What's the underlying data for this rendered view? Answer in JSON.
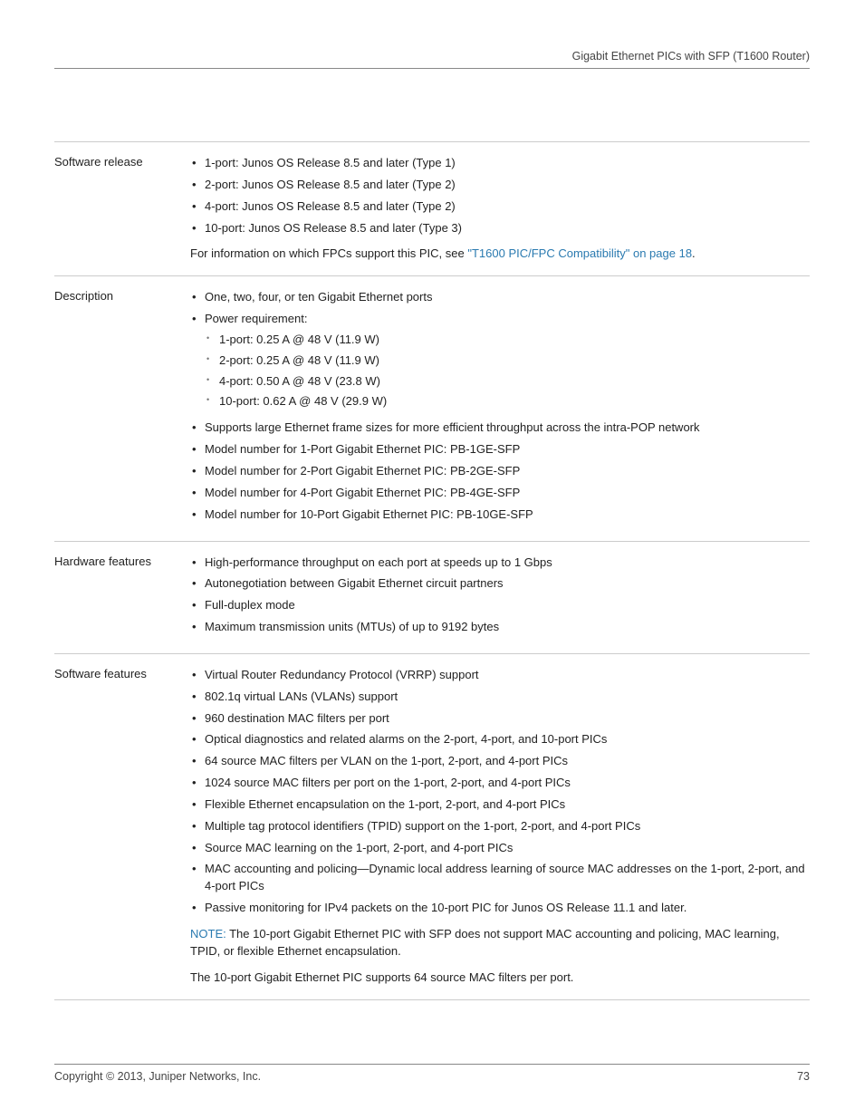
{
  "header": {
    "title": "Gigabit Ethernet PICs with SFP (T1600 Router)"
  },
  "rows": {
    "software_release": {
      "label": "Software release",
      "items": [
        "1-port: Junos OS Release 8.5 and later (Type 1)",
        "2-port: Junos OS Release 8.5 and later (Type 2)",
        "4-port: Junos OS Release 8.5 and later (Type 2)",
        "10-port: Junos OS Release 8.5 and later (Type 3)"
      ],
      "after_text_pre": "For information on which FPCs support this PIC, see ",
      "after_link": "\"T1600 PIC/FPC Compatibility\" on page 18",
      "after_text_post": "."
    },
    "description": {
      "label": "Description",
      "item1": "One, two, four, or ten Gigabit Ethernet ports",
      "item2": "Power requirement:",
      "power": [
        "1-port: 0.25 A @ 48 V (11.9 W)",
        "2-port: 0.25 A @ 48 V (11.9 W)",
        "4-port: 0.50 A @ 48 V (23.8 W)",
        "10-port: 0.62 A @ 48 V (29.9 W)"
      ],
      "rest": [
        "Supports large Ethernet frame sizes for more efficient throughput across the intra-POP network",
        "Model number for 1-Port Gigabit Ethernet PIC: PB-1GE-SFP",
        "Model number for 2-Port Gigabit Ethernet PIC: PB-2GE-SFP",
        "Model number for 4-Port Gigabit Ethernet PIC: PB-4GE-SFP",
        "Model number for 10-Port Gigabit Ethernet PIC: PB-10GE-SFP"
      ]
    },
    "hardware_features": {
      "label": "Hardware features",
      "items": [
        "High-performance throughput on each port at speeds up to 1 Gbps",
        "Autonegotiation between Gigabit Ethernet circuit partners",
        "Full-duplex mode",
        "Maximum transmission units (MTUs) of up to 9192 bytes"
      ]
    },
    "software_features": {
      "label": "Software features",
      "items": [
        "Virtual Router Redundancy Protocol (VRRP) support",
        "802.1q virtual LANs (VLANs) support",
        "960 destination MAC filters per port",
        "Optical diagnostics and related alarms on the 2-port, 4-port, and 10-port PICs",
        "64 source MAC filters per VLAN on the 1-port, 2-port, and 4-port PICs",
        "1024 source MAC filters per port on the 1-port, 2-port, and 4-port PICs",
        "Flexible Ethernet encapsulation on the 1-port, 2-port, and 4-port PICs",
        "Multiple tag protocol identifiers (TPID) support on the 1-port, 2-port, and 4-port PICs",
        "Source MAC learning on the 1-port, 2-port, and 4-port PICs",
        "MAC accounting and policing—Dynamic local address learning of source MAC addresses on the 1-port, 2-port, and 4-port PICs",
        "Passive monitoring for IPv4 packets on the 10-port PIC for Junos OS Release 11.1 and later."
      ],
      "note_label": "NOTE:",
      "note_text": "  The 10-port Gigabit Ethernet PIC with SFP does not support MAC accounting and policing, MAC learning, TPID, or flexible Ethernet encapsulation.",
      "footer_text": "The 10-port Gigabit Ethernet PIC supports 64 source MAC filters per port."
    }
  },
  "footer": {
    "copyright": "Copyright © 2013, Juniper Networks, Inc.",
    "page_number": "73"
  }
}
